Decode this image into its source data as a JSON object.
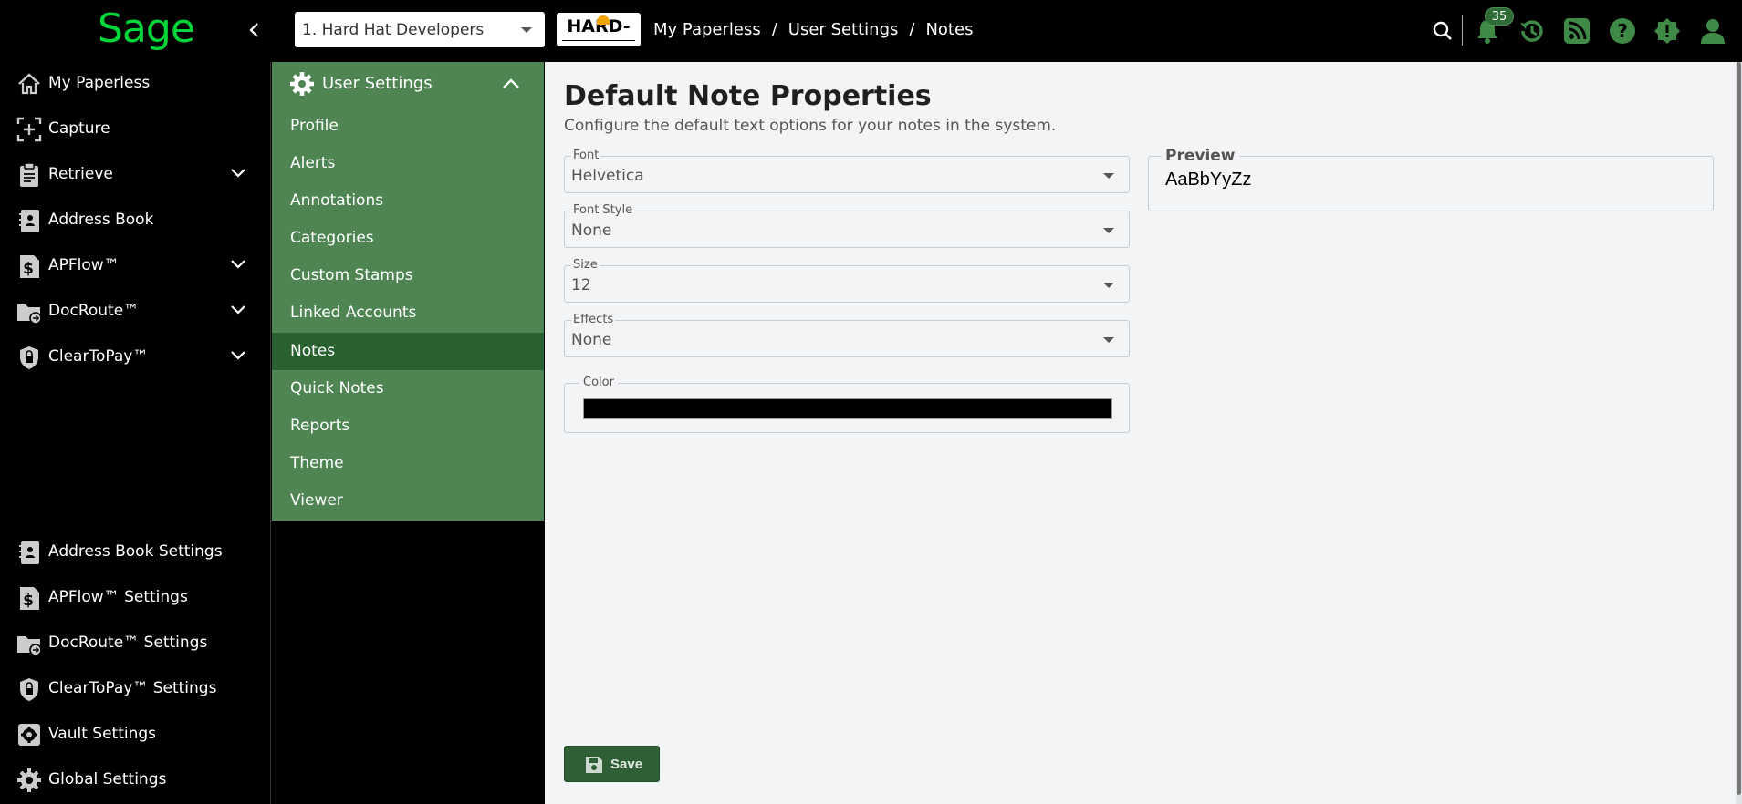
{
  "header": {
    "logo_text": "Sage",
    "company_select_value": "1. Hard Hat Developers",
    "company_logo_text": "HARD-HAT",
    "breadcrumb": [
      "My Paperless",
      "User Settings",
      "Notes"
    ],
    "breadcrumb_separator": "/",
    "notification_count": "35",
    "icons": [
      "search-icon",
      "bell-icon",
      "history-icon",
      "rss-icon",
      "help-icon",
      "alert-icon",
      "user-icon"
    ]
  },
  "sidebar": {
    "items": [
      {
        "label": "My Paperless",
        "icon": "home-icon"
      },
      {
        "label": "Capture",
        "icon": "capture-icon"
      },
      {
        "label": "Retrieve",
        "icon": "clipboard-icon"
      },
      {
        "label": "Address Book",
        "icon": "address-book-icon"
      },
      {
        "label": "APFlow™",
        "icon": "dollar-doc-icon"
      },
      {
        "label": "DocRoute™",
        "icon": "folder-route-icon"
      },
      {
        "label": "ClearToPay™",
        "icon": "shield-lock-icon"
      }
    ],
    "settings_items": [
      {
        "label": "Address Book Settings",
        "icon": "address-book-icon"
      },
      {
        "label": "APFlow™ Settings",
        "icon": "dollar-doc-icon"
      },
      {
        "label": "DocRoute™ Settings",
        "icon": "folder-route-icon"
      },
      {
        "label": "ClearToPay™ Settings",
        "icon": "shield-lock-icon"
      },
      {
        "label": "Vault Settings",
        "icon": "gear-icon"
      },
      {
        "label": "Global Settings",
        "icon": "gear-icon"
      }
    ]
  },
  "settings_menu": {
    "title": "User Settings",
    "items": [
      "Profile",
      "Alerts",
      "Annotations",
      "Categories",
      "Custom Stamps",
      "Linked Accounts",
      "Notes",
      "Quick Notes",
      "Reports",
      "Theme",
      "Viewer"
    ],
    "active": "Notes"
  },
  "main": {
    "title": "Default Note Properties",
    "subtitle": "Configure the default text options for your notes in the system.",
    "fields": {
      "font": {
        "label": "Font",
        "value": "Helvetica"
      },
      "font_style": {
        "label": "Font Style",
        "value": "None"
      },
      "size": {
        "label": "Size",
        "value": "12"
      },
      "effects": {
        "label": "Effects",
        "value": "None"
      },
      "color": {
        "label": "Color",
        "value": "#000000"
      }
    },
    "preview": {
      "label": "Preview",
      "text": "AaBbYyZz"
    },
    "save_label": "Save"
  },
  "colors": {
    "brand_green": "#00d639",
    "panel_green": "#4e8553",
    "active_green": "#2a6131",
    "button_green": "#2f5f36"
  }
}
